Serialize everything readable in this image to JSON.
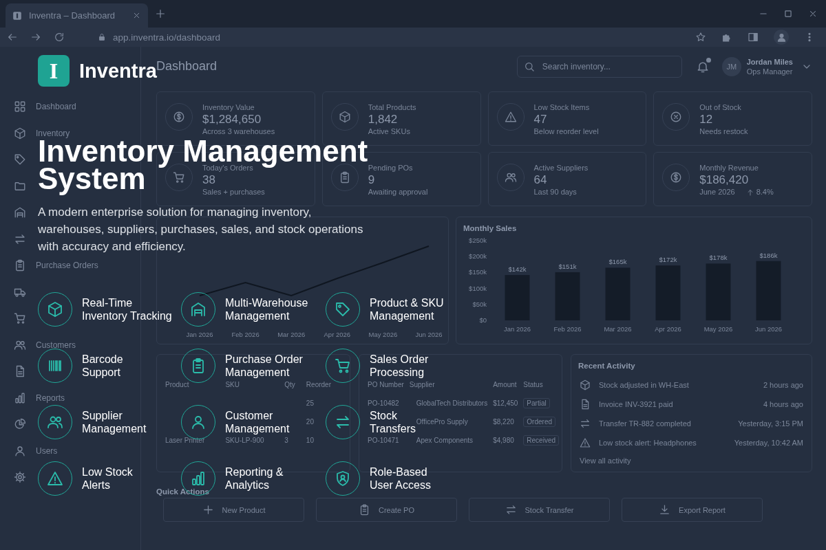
{
  "browser": {
    "tab_title": "Inventra – Dashboard",
    "url": "app.inventra.io/dashboard"
  },
  "sidebar": {
    "items": [
      {
        "label": "Dashboard"
      },
      {
        "label": "Inventory"
      },
      {
        "label": "Purchase Orders"
      },
      {
        "label": "Customers"
      },
      {
        "label": "Reports"
      },
      {
        "label": "Users"
      }
    ]
  },
  "header": {
    "title": "Dashboard",
    "search": {
      "placeholder": "Search inventory..."
    },
    "notifications": {
      "unread": true
    },
    "user": {
      "initials": "JM",
      "name": "Jordan Miles",
      "role": "Ops Manager"
    }
  },
  "kpis": [
    {
      "label": "Inventory Value",
      "value": "$1,284,650",
      "note": "Across 3 warehouses"
    },
    {
      "label": "Total Products",
      "value": "1,842",
      "note": "Active SKUs"
    },
    {
      "label": "Low Stock Items",
      "value": "47",
      "note": "Below reorder level"
    },
    {
      "label": "Out of Stock",
      "value": "12",
      "note": "Needs restock"
    },
    {
      "label": "Today's Orders",
      "value": "38",
      "note": "Sales + purchases"
    },
    {
      "label": "Pending POs",
      "value": "9",
      "note": "Awaiting approval"
    },
    {
      "label": "Active Suppliers",
      "value": "64",
      "note": "Last 90 days"
    },
    {
      "label": "Monthly Revenue",
      "value": "$186,420",
      "note": "June 2026",
      "change": "8.4%"
    }
  ],
  "trend": {
    "categories": [
      "Jan 2026",
      "Feb 2026",
      "Mar 2026",
      "Apr 2026",
      "May 2026",
      "Jun 2026"
    ]
  },
  "sales": {
    "title": "Monthly Sales",
    "chart_data": {
      "type": "bar",
      "categories": [
        "Jan 2026",
        "Feb 2026",
        "Mar 2026",
        "Apr 2026",
        "May 2026",
        "Jun 2026"
      ],
      "values": [
        142,
        151,
        165,
        172,
        178,
        186
      ],
      "ylim": [
        0,
        250
      ],
      "yticks": [
        {
          "value": 0,
          "label": "$0"
        },
        {
          "value": 50,
          "label": "$50k"
        },
        {
          "value": 100,
          "label": "$100k"
        },
        {
          "value": 150,
          "label": "$150k"
        },
        {
          "value": 200,
          "label": "$200k"
        },
        {
          "value": 250,
          "label": "$250k"
        }
      ],
      "value_labels": [
        "$142k",
        "$151k",
        "$165k",
        "$172k",
        "$178k",
        "$186k"
      ]
    }
  },
  "low_stock": {
    "columns": [
      "Product",
      "SKU",
      "Qty",
      "Reorder"
    ],
    "rows": [
      {
        "reorder": "25"
      },
      {
        "reorder": "20"
      },
      {
        "product": "Laser Printer",
        "sku": "SKU-LP-900",
        "qty": "3",
        "reorder": "10"
      }
    ]
  },
  "purchase_orders": {
    "columns": [
      "PO Number",
      "Supplier",
      "Amount",
      "Status"
    ],
    "rows": [
      {
        "po": "PO-10482",
        "supplier": "GlobalTech Distributors",
        "amount": "$12,450",
        "status": "Partial"
      },
      {
        "supplier": "OfficePro Supply",
        "amount": "$8,220",
        "status": "Ordered"
      },
      {
        "po": "PO-10471",
        "supplier": "Apex Components",
        "amount": "$4,980",
        "status": "Received"
      }
    ]
  },
  "activity": {
    "title": "Recent Activity",
    "items": [
      {
        "text": "Stock adjusted in WH-East",
        "time": "2 hours ago"
      },
      {
        "text": "Invoice INV-3921 paid",
        "time": "4 hours ago"
      },
      {
        "text": "Transfer TR-882 completed",
        "time": "Yesterday, 3:15 PM"
      },
      {
        "text": "Low stock alert: Headphones",
        "time": "Yesterday, 10:42 AM"
      }
    ],
    "link": "View all activity"
  },
  "quick_actions": {
    "title": "Quick Actions",
    "buttons": [
      {
        "label": "New Product"
      },
      {
        "label": "Create PO"
      },
      {
        "label": "Stock Transfer"
      },
      {
        "label": "Export Report"
      }
    ]
  },
  "promo": {
    "logo_letter": "I",
    "brand": "Inventra",
    "headline_lines": [
      "Inventory Management",
      "System"
    ],
    "description": "A modern enterprise solution for managing inventory, warehouses, suppliers, purchases, sales, and stock operations with accuracy and efficiency.",
    "features": [
      {
        "label": "Real-Time\nInventory Tracking"
      },
      {
        "label": "Multi-Warehouse\nManagement"
      },
      {
        "label": "Product & SKU\nManagement"
      },
      {
        "label": "Barcode\nSupport"
      },
      {
        "label": "Purchase Order\nManagement"
      },
      {
        "label": "Sales Order\nProcessing"
      },
      {
        "label": "Supplier\nManagement"
      },
      {
        "label": "Customer\nManagement"
      },
      {
        "label": "Stock\nTransfers"
      },
      {
        "label": "Low Stock\nAlerts"
      },
      {
        "label": "Reporting &\nAnalytics"
      },
      {
        "label": "Role-Based\nUser Access"
      }
    ]
  }
}
